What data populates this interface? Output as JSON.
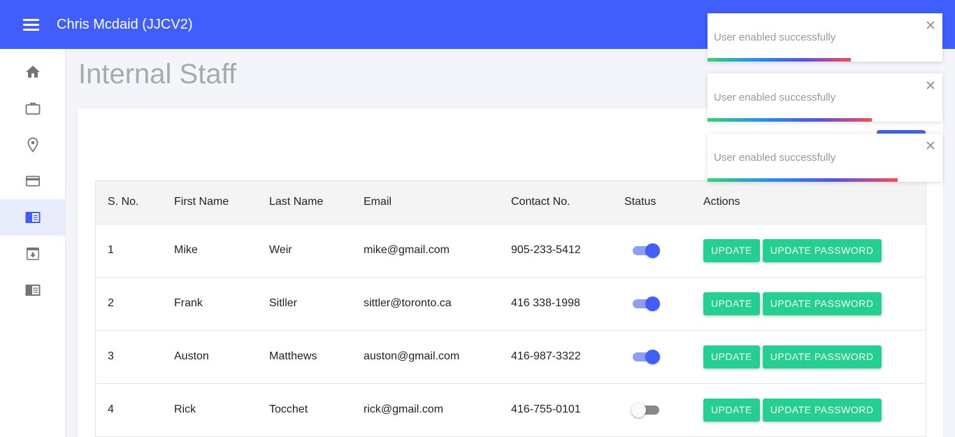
{
  "header": {
    "title": "Chris Mcdaid (JJCV2)"
  },
  "sidebar": {
    "items": [
      {
        "icon": "home-icon",
        "active": false
      },
      {
        "icon": "briefcase-icon",
        "active": false
      },
      {
        "icon": "location-pin-icon",
        "active": false
      },
      {
        "icon": "credit-card-icon",
        "active": false
      },
      {
        "icon": "staff-list-icon",
        "active": true
      },
      {
        "icon": "archive-icon",
        "active": false
      },
      {
        "icon": "list-icon",
        "active": false
      }
    ]
  },
  "page": {
    "title": "Internal Staff"
  },
  "table": {
    "headers": [
      "S. No.",
      "First Name",
      "Last Name",
      "Email",
      "Contact No.",
      "Status",
      "Actions"
    ],
    "rows": [
      {
        "sno": "1",
        "first": "Mike",
        "last": "Weir",
        "email": "mike@gmail.com",
        "contact": "905-233-5412",
        "enabled": true
      },
      {
        "sno": "2",
        "first": "Frank",
        "last": "Sitller",
        "email": "sittler@toronto.ca",
        "contact": "416 338-1998",
        "enabled": true
      },
      {
        "sno": "3",
        "first": "Auston",
        "last": "Matthews",
        "email": "auston@gmail.com",
        "contact": "416-987-3322",
        "enabled": true
      },
      {
        "sno": "4",
        "first": "Rick",
        "last": "Tocchet",
        "email": "rick@gmail.com",
        "contact": "416-755-0101",
        "enabled": false
      }
    ],
    "update_label": "UPDATE",
    "update_password_label": "UPDATE PASSWORD"
  },
  "toasts": [
    {
      "message": "User enabled successfully",
      "progress": 0.61
    },
    {
      "message": "User enabled successfully",
      "progress": 0.7
    },
    {
      "message": "User enabled successfully",
      "progress": 0.81
    }
  ],
  "colors": {
    "primary": "#3f5efb",
    "success": "#23d092",
    "sidebar_active": "#e9edfb"
  }
}
